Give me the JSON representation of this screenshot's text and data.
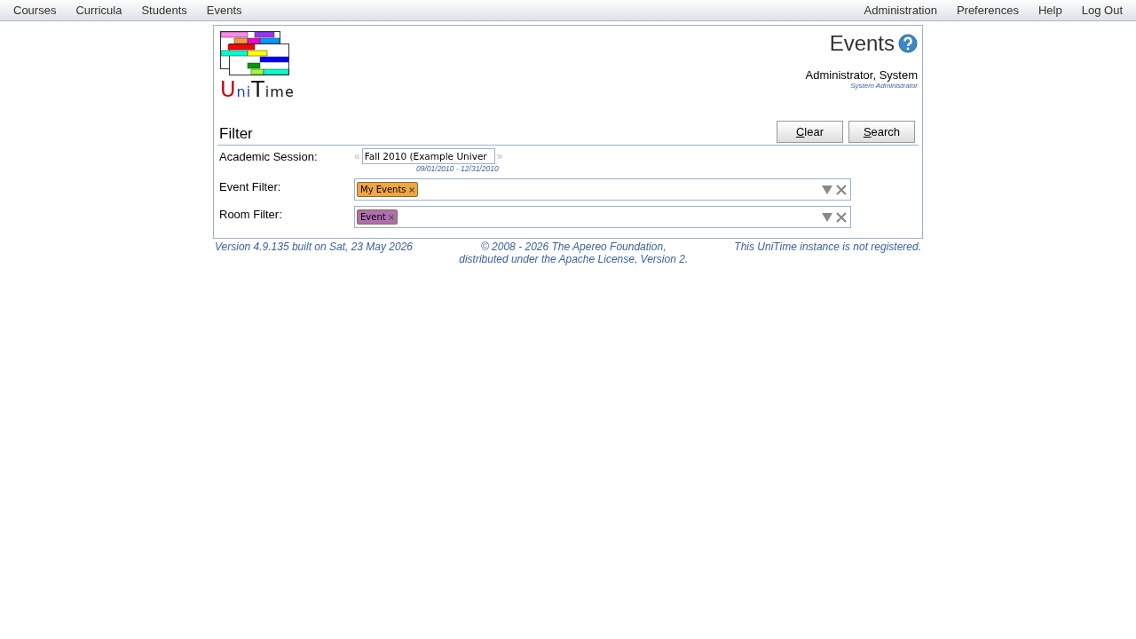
{
  "menu_left": [
    "Courses",
    "Curricula",
    "Students",
    "Events"
  ],
  "menu_right": [
    "Administration",
    "Preferences",
    "Help",
    "Log Out"
  ],
  "logo": [
    {
      "text": "U",
      "color": "#cc0000"
    },
    {
      "text": "ni",
      "color": "#1a3fa8"
    },
    {
      "text": "T",
      "color": "#111111"
    },
    {
      "text": "ime",
      "color": "#111111"
    }
  ],
  "page_title": "Events",
  "user": {
    "name": "Administrator, System",
    "role": "System Administrator"
  },
  "filter": {
    "header": "Filter",
    "buttons": [
      "Clear",
      "Search"
    ],
    "session": {
      "label": "Academic Session:",
      "prev": "«",
      "value": "Fall 2010 (Example Univer",
      "next": "»",
      "dates": "09/01/2010 - 12/31/2010"
    },
    "fields": [
      {
        "label": "Event Filter:",
        "tags": [
          {
            "text": "My Events",
            "color": "#f0a640"
          }
        ]
      },
      {
        "label": "Room Filter:",
        "tags": [
          {
            "text": "Event",
            "color": "#b06fb0"
          }
        ]
      }
    ]
  },
  "footer": {
    "version": "Version 4.9.135 built on Sat, 23 May 2026",
    "copyright": [
      "© 2008 - 2026 The Apereo Foundation,",
      "distributed under the Apache License, Version 2."
    ],
    "registration": "This UniTime instance is not registered."
  }
}
